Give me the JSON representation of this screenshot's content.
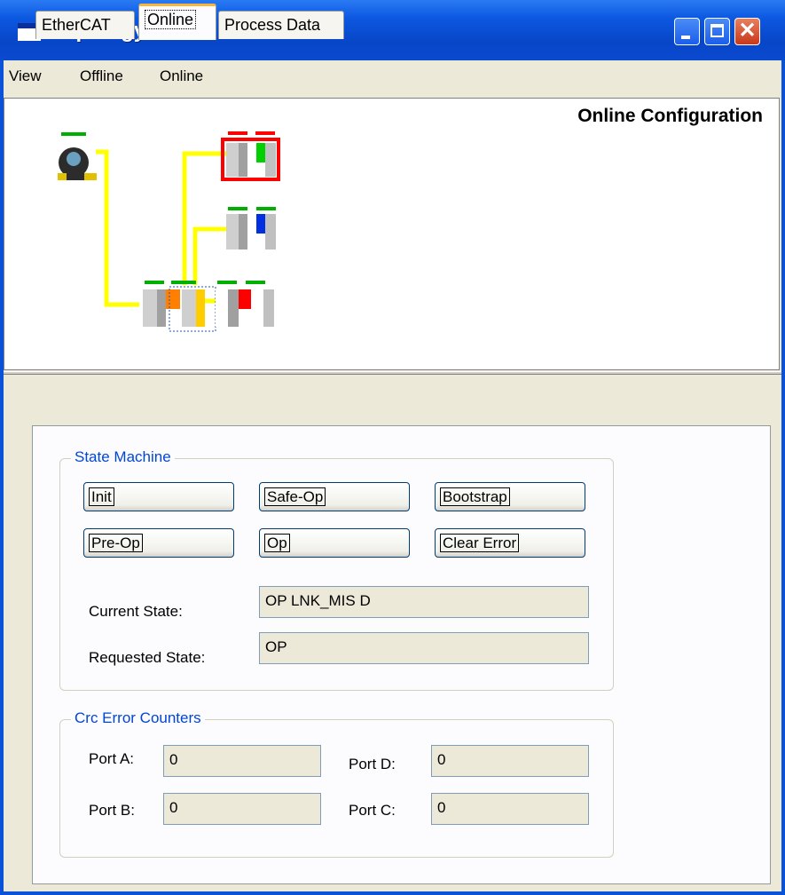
{
  "window": {
    "title": "Topology"
  },
  "menu": {
    "items": [
      "View",
      "Offline",
      "Online"
    ]
  },
  "topology": {
    "title": "Online Configuration"
  },
  "tabs": {
    "items": [
      {
        "label": "EtherCAT",
        "active": false
      },
      {
        "label": "Online",
        "active": true
      },
      {
        "label": "Process Data",
        "active": false
      }
    ]
  },
  "state_machine": {
    "title": "State Machine",
    "buttons": {
      "init": "Init",
      "safe_op": "Safe-Op",
      "bootstrap": "Bootstrap",
      "pre_op": "Pre-Op",
      "op": "Op",
      "clear_error": "Clear Error"
    },
    "current_state_label": "Current State:",
    "current_state_value": "OP LNK_MIS D",
    "requested_state_label": "Requested State:",
    "requested_state_value": "OP"
  },
  "crc": {
    "title": "Crc Error Counters",
    "port_a_label": "Port A:",
    "port_a_value": "0",
    "port_b_label": "Port B:",
    "port_b_value": "0",
    "port_d_label": "Port D:",
    "port_d_value": "0",
    "port_c_label": "Port C:",
    "port_c_value": "0"
  },
  "colors": {
    "link": "#ffff00",
    "status_ok": "#00b000",
    "status_err": "#ff0000",
    "title_blue": "#0a52d8",
    "group_title": "#0046d5"
  }
}
